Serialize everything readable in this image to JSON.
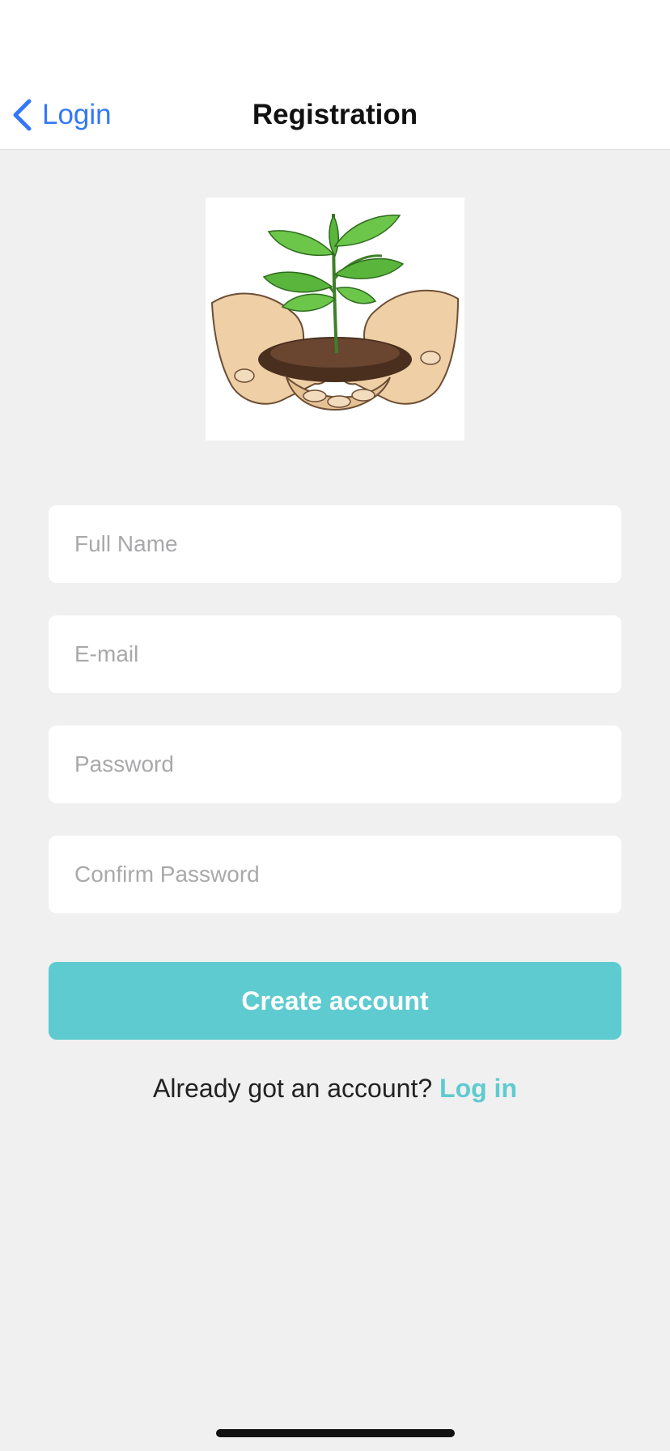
{
  "nav": {
    "back_label": "Login",
    "title": "Registration"
  },
  "logo": {
    "icon": "hands-holding-seedling-illustration"
  },
  "form": {
    "full_name": {
      "value": "",
      "placeholder": "Full Name"
    },
    "email": {
      "value": "",
      "placeholder": "E-mail"
    },
    "password": {
      "value": "",
      "placeholder": "Password"
    },
    "confirm_password": {
      "value": "",
      "placeholder": "Confirm Password"
    },
    "submit_label": "Create account"
  },
  "footer": {
    "prompt": "Already got an account?",
    "link_label": "Log in"
  },
  "colors": {
    "accent": "#5ecbd0",
    "back_link": "#3478f6",
    "background": "#f0f0f0"
  }
}
